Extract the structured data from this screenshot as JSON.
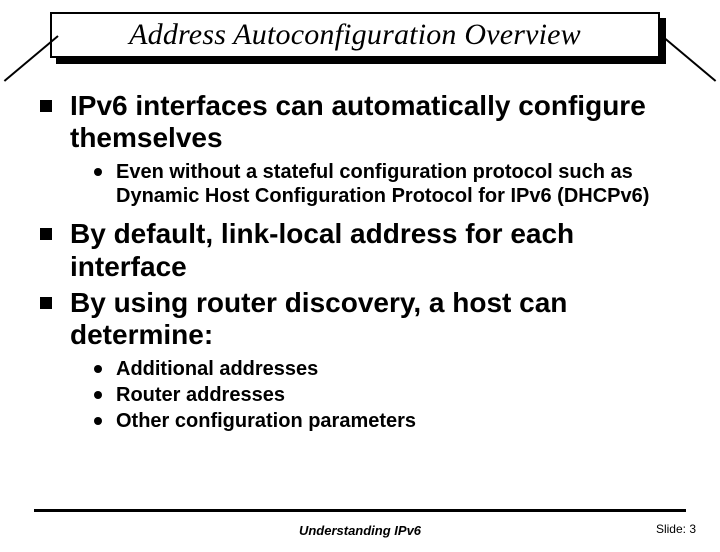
{
  "title": "Address Autoconfiguration Overview",
  "bullets": {
    "b1": "IPv6 interfaces can automatically configure themselves",
    "b1_sub1": "Even without a stateful configuration protocol such as Dynamic Host Configuration Protocol for IPv6 (DHCPv6)",
    "b2": "By default, link-local address for each interface",
    "b3": "By using router discovery, a host can determine:",
    "b3_sub1": "Additional addresses",
    "b3_sub2": "Router addresses",
    "b3_sub3": "Other configuration parameters"
  },
  "footer": {
    "center": "Understanding IPv6",
    "right": "Slide: 3"
  }
}
